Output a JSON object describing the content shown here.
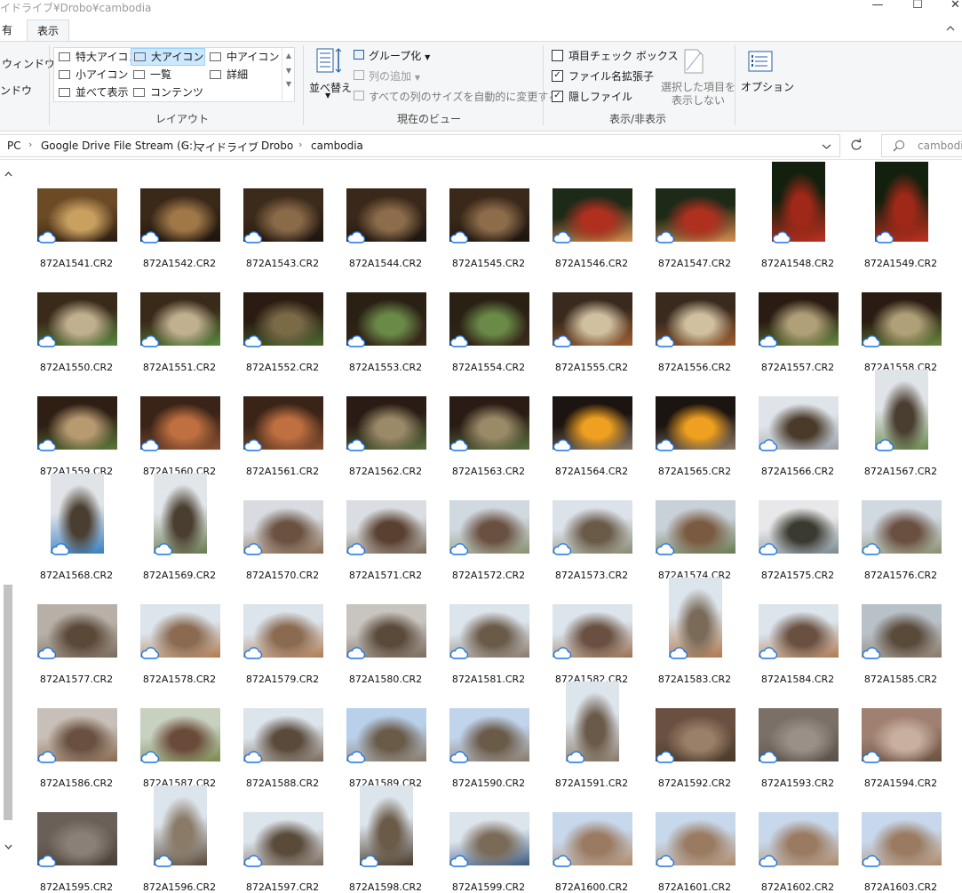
{
  "window": {
    "title": "イドライブ¥Drobo¥cambodia",
    "min_label": "—",
    "max_label": "☐",
    "close_label": "✕"
  },
  "tabs": {
    "share_partial": "有",
    "view_label": "表示",
    "collapse_icon": "chevron-up-icon"
  },
  "ribbon": {
    "left_partial": [
      "ウィンドウ",
      "ンドウ"
    ],
    "layout": {
      "items": [
        "特大アイコン",
        "大アイコン",
        "中アイコン",
        "小アイコン",
        "一覧",
        "詳細",
        "並べて表示",
        "コンテンツ"
      ],
      "selected": "大アイコン",
      "group_label": "レイアウト"
    },
    "current_view": {
      "sort_label": "並べ替え",
      "group_by": "グループ化",
      "add_columns": "列の追加",
      "size_all_columns": "すべての列のサイズを自動的に変更する",
      "group_label": "現在のビュー"
    },
    "show_hide": {
      "item_checkboxes": "項目チェック ボックス",
      "file_name_extensions": "ファイル名拡張子",
      "hidden_items": "隠しファイル",
      "hide_selected_line1": "選択した項目を",
      "hide_selected_line2": "表示しない",
      "group_label": "表示/非表示",
      "checked": {
        "item_checkboxes": false,
        "file_name_extensions": true,
        "hidden_items": true
      }
    },
    "options_label": "オプション"
  },
  "address": {
    "crumbs": [
      "PC",
      "Google Drive File Stream (G:)",
      "マイドライブ",
      "Drobo",
      "cambodia"
    ],
    "search_placeholder": "cambodi..."
  },
  "files": [
    {
      "name": "872A1541.CR2",
      "colors": [
        "#6b4a25",
        "#c9a060",
        "#2a1c10"
      ],
      "orient": "land"
    },
    {
      "name": "872A1542.CR2",
      "colors": [
        "#3a2818",
        "#a07848",
        "#1e140c"
      ],
      "orient": "land"
    },
    {
      "name": "872A1543.CR2",
      "colors": [
        "#3c2a1a",
        "#8a6a48",
        "#1c140e"
      ],
      "orient": "land"
    },
    {
      "name": "872A1544.CR2",
      "colors": [
        "#3a281a",
        "#8c6c4a",
        "#1c140e"
      ],
      "orient": "land"
    },
    {
      "name": "872A1545.CR2",
      "colors": [
        "#3a281a",
        "#8c6c4a",
        "#1c140e"
      ],
      "orient": "land"
    },
    {
      "name": "872A1546.CR2",
      "colors": [
        "#1e2a18",
        "#b03020",
        "#d89050"
      ],
      "orient": "land"
    },
    {
      "name": "872A1547.CR2",
      "colors": [
        "#1e2a18",
        "#b03020",
        "#d89050"
      ],
      "orient": "land"
    },
    {
      "name": "872A1548.CR2",
      "colors": [
        "#14200e",
        "#a02818",
        "#c03020"
      ],
      "orient": "port"
    },
    {
      "name": "872A1549.CR2",
      "colors": [
        "#14200e",
        "#a02818",
        "#c03020"
      ],
      "orient": "port"
    },
    {
      "name": "872A1550.CR2",
      "colors": [
        "#3a2a1a",
        "#c0b090",
        "#5a8a40"
      ],
      "orient": "land"
    },
    {
      "name": "872A1551.CR2",
      "colors": [
        "#3a2a1a",
        "#c0b090",
        "#5a8a40"
      ],
      "orient": "land"
    },
    {
      "name": "872A1552.CR2",
      "colors": [
        "#2a1c12",
        "#7a6a48",
        "#4a6a30"
      ],
      "orient": "land"
    },
    {
      "name": "872A1553.CR2",
      "colors": [
        "#2a2014",
        "#6a8a48",
        "#3a2a1a"
      ],
      "orient": "land"
    },
    {
      "name": "872A1554.CR2",
      "colors": [
        "#2a2014",
        "#6a8a48",
        "#3a2a1a"
      ],
      "orient": "land"
    },
    {
      "name": "872A1555.CR2",
      "colors": [
        "#3a2a1e",
        "#d0c0a0",
        "#a06030"
      ],
      "orient": "land"
    },
    {
      "name": "872A1556.CR2",
      "colors": [
        "#3a2a1e",
        "#d0c0a0",
        "#a06030"
      ],
      "orient": "land"
    },
    {
      "name": "872A1557.CR2",
      "colors": [
        "#2a1c12",
        "#b0a078",
        "#6a8a40"
      ],
      "orient": "land"
    },
    {
      "name": "872A1558.CR2",
      "colors": [
        "#2a1c12",
        "#b0a078",
        "#6a8a40"
      ],
      "orient": "land"
    },
    {
      "name": "872A1559.CR2",
      "colors": [
        "#2e1e14",
        "#b89a70",
        "#5a7a3a"
      ],
      "orient": "land"
    },
    {
      "name": "872A1560.CR2",
      "colors": [
        "#3a2418",
        "#c07040",
        "#8a5030"
      ],
      "orient": "land"
    },
    {
      "name": "872A1561.CR2",
      "colors": [
        "#3a2418",
        "#c07040",
        "#8a5030"
      ],
      "orient": "land"
    },
    {
      "name": "872A1562.CR2",
      "colors": [
        "#2a1c14",
        "#9a8a68",
        "#5a7040"
      ],
      "orient": "land"
    },
    {
      "name": "872A1563.CR2",
      "colors": [
        "#2a1c14",
        "#9a8a68",
        "#5a7040"
      ],
      "orient": "land"
    },
    {
      "name": "872A1564.CR2",
      "colors": [
        "#1c1410",
        "#f0a020",
        "#8a7a6a"
      ],
      "orient": "land"
    },
    {
      "name": "872A1565.CR2",
      "colors": [
        "#1c1410",
        "#f0a020",
        "#8a7a6a"
      ],
      "orient": "land"
    },
    {
      "name": "872A1566.CR2",
      "colors": [
        "#dfe4ea",
        "#4a3a2a",
        "#9aa0a8"
      ],
      "orient": "land"
    },
    {
      "name": "872A1567.CR2",
      "colors": [
        "#e0e4e8",
        "#4a3e30",
        "#6a8a50"
      ],
      "orient": "port"
    },
    {
      "name": "872A1568.CR2",
      "colors": [
        "#e0e4e8",
        "#4a3e30",
        "#3a80c0"
      ],
      "orient": "port"
    },
    {
      "name": "872A1569.CR2",
      "colors": [
        "#e2e6ea",
        "#4a3e30",
        "#6a7a50"
      ],
      "orient": "port"
    },
    {
      "name": "872A1570.CR2",
      "colors": [
        "#d8dce0",
        "#6a5240",
        "#8a6a50"
      ],
      "orient": "land"
    },
    {
      "name": "872A1571.CR2",
      "colors": [
        "#dadee2",
        "#5a4030",
        "#7a6a5a"
      ],
      "orient": "land"
    },
    {
      "name": "872A1572.CR2",
      "colors": [
        "#d0d8e0",
        "#6a5040",
        "#8a9070"
      ],
      "orient": "land"
    },
    {
      "name": "872A1573.CR2",
      "colors": [
        "#dce2ea",
        "#6a5a48",
        "#8a8a70"
      ],
      "orient": "land"
    },
    {
      "name": "872A1574.CR2",
      "colors": [
        "#c8d0d8",
        "#7a5a40",
        "#6a7a50"
      ],
      "orient": "land"
    },
    {
      "name": "872A1575.CR2",
      "colors": [
        "#e8e8ea",
        "#3a3a30",
        "#7a8a90"
      ],
      "orient": "land"
    },
    {
      "name": "872A1576.CR2",
      "colors": [
        "#d0d8e0",
        "#6a5040",
        "#8a9070"
      ],
      "orient": "land"
    },
    {
      "name": "872A1577.CR2",
      "colors": [
        "#b8b0a8",
        "#5a4838",
        "#7a6a5a"
      ],
      "orient": "land"
    },
    {
      "name": "872A1578.CR2",
      "colors": [
        "#dce4ec",
        "#8a6a50",
        "#b07a50"
      ],
      "orient": "land"
    },
    {
      "name": "872A1579.CR2",
      "colors": [
        "#dce4ec",
        "#8a6a50",
        "#b07a50"
      ],
      "orient": "land"
    },
    {
      "name": "872A1580.CR2",
      "colors": [
        "#c8c4c0",
        "#5a4a3a",
        "#7a6a5a"
      ],
      "orient": "land"
    },
    {
      "name": "872A1581.CR2",
      "colors": [
        "#dce4ec",
        "#6a5a48",
        "#8a7a6a"
      ],
      "orient": "land"
    },
    {
      "name": "872A1582.CR2",
      "colors": [
        "#dce4ec",
        "#6a5040",
        "#9a7050"
      ],
      "orient": "land"
    },
    {
      "name": "872A1583.CR2",
      "colors": [
        "#dce4ec",
        "#7a6a58",
        "#b07a50"
      ],
      "orient": "port"
    },
    {
      "name": "872A1584.CR2",
      "colors": [
        "#dce4ec",
        "#6a5040",
        "#b07a50"
      ],
      "orient": "land"
    },
    {
      "name": "872A1585.CR2",
      "colors": [
        "#b8c0c8",
        "#5a4a3a",
        "#8a7a68"
      ],
      "orient": "land"
    },
    {
      "name": "872A1586.CR2",
      "colors": [
        "#c8c0b8",
        "#6a5040",
        "#8a6a50"
      ],
      "orient": "land"
    },
    {
      "name": "872A1587.CR2",
      "colors": [
        "#c8d0c0",
        "#6a4a38",
        "#7a8a50"
      ],
      "orient": "land"
    },
    {
      "name": "872A1588.CR2",
      "colors": [
        "#dce4ec",
        "#5a4a3a",
        "#7a6a5a"
      ],
      "orient": "land"
    },
    {
      "name": "872A1589.CR2",
      "colors": [
        "#b8d0ea",
        "#6a5a48",
        "#8a7a68"
      ],
      "orient": "land"
    },
    {
      "name": "872A1590.CR2",
      "colors": [
        "#c0d4ec",
        "#6a5a48",
        "#8a7a68"
      ],
      "orient": "land"
    },
    {
      "name": "872A1591.CR2",
      "colors": [
        "#dce4ec",
        "#6a5a48",
        "#8a7a68"
      ],
      "orient": "port"
    },
    {
      "name": "872A1592.CR2",
      "colors": [
        "#6a5040",
        "#9a8068",
        "#4a3a2a"
      ],
      "orient": "land"
    },
    {
      "name": "872A1593.CR2",
      "colors": [
        "#7a7068",
        "#9a9088",
        "#5a5048"
      ],
      "orient": "land"
    },
    {
      "name": "872A1594.CR2",
      "colors": [
        "#a08070",
        "#c8b0a0",
        "#6a5040"
      ],
      "orient": "land"
    },
    {
      "name": "872A1595.CR2",
      "colors": [
        "#6a6058",
        "#8a8078",
        "#4a4038"
      ],
      "orient": "land"
    },
    {
      "name": "872A1596.CR2",
      "colors": [
        "#dce4ec",
        "#8a7a68",
        "#5a4a3a"
      ],
      "orient": "port"
    },
    {
      "name": "872A1597.CR2",
      "colors": [
        "#dce4ec",
        "#5a4a3a",
        "#7a6a5a"
      ],
      "orient": "land"
    },
    {
      "name": "872A1598.CR2",
      "colors": [
        "#dce4ec",
        "#6a5a48",
        "#4a3a2a"
      ],
      "orient": "port"
    },
    {
      "name": "872A1599.CR2",
      "colors": [
        "#dce4ec",
        "#7a6a58",
        "#3a5a80"
      ],
      "orient": "land"
    },
    {
      "name": "872A1600.CR2",
      "colors": [
        "#c8d8ec",
        "#9a7a60",
        "#b08a68"
      ],
      "orient": "land"
    },
    {
      "name": "872A1601.CR2",
      "colors": [
        "#c8d8ec",
        "#9a7a60",
        "#b08a68"
      ],
      "orient": "land"
    },
    {
      "name": "872A1602.CR2",
      "colors": [
        "#c8d8ec",
        "#9a7a60",
        "#b08a68"
      ],
      "orient": "land"
    },
    {
      "name": "872A1603.CR2",
      "colors": [
        "#c8d8ec",
        "#9a7a60",
        "#b08a68"
      ],
      "orient": "land"
    }
  ],
  "status_icon": "cloud-icon",
  "accent": "#0078d7"
}
